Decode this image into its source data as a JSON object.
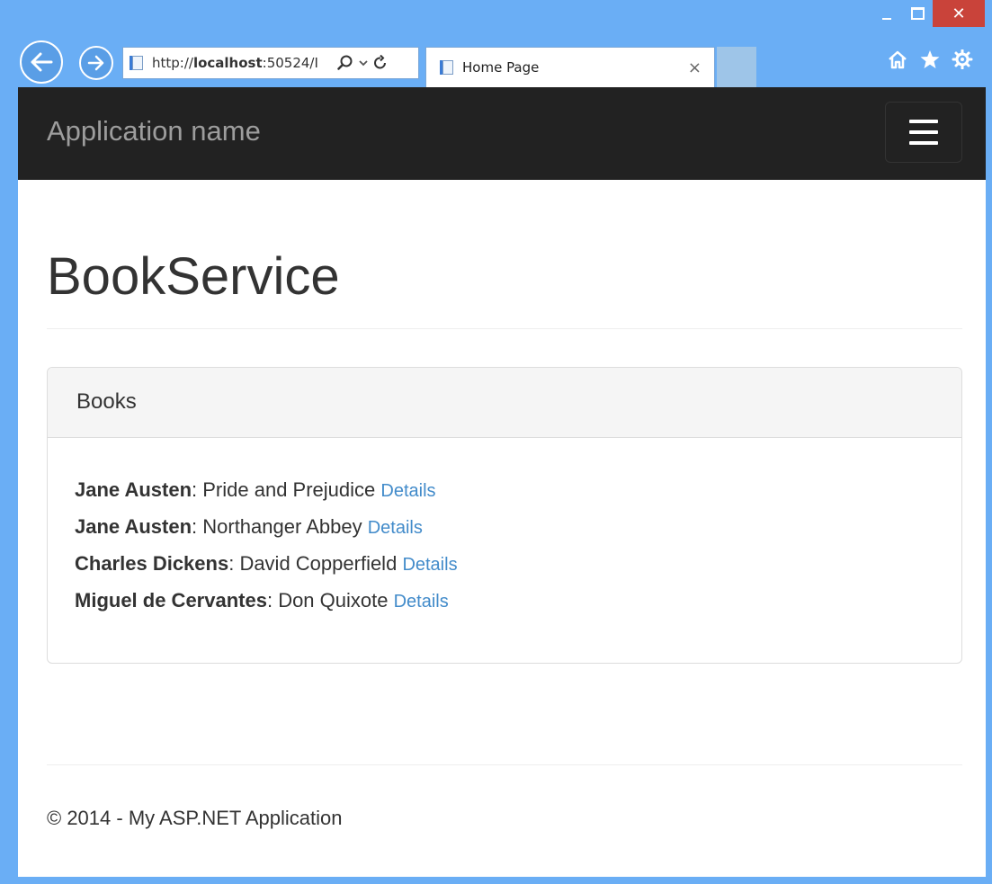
{
  "browser": {
    "url_prefix": "http://",
    "url_host": "localhost",
    "url_rest": ":50524/I",
    "tab_title": "Home Page",
    "tab_close": "×",
    "close_glyph": "✕"
  },
  "navbar": {
    "brand": "Application name"
  },
  "page": {
    "title": "BookService"
  },
  "panel": {
    "title": "Books",
    "books": [
      {
        "author": "Jane Austen",
        "separator": ": ",
        "title": "Pride and Prejudice",
        "link": "Details"
      },
      {
        "author": "Jane Austen",
        "separator": ": ",
        "title": "Northanger Abbey",
        "link": "Details"
      },
      {
        "author": "Charles Dickens",
        "separator": ": ",
        "title": "David Copperfield",
        "link": "Details"
      },
      {
        "author": "Miguel de Cervantes",
        "separator": ": ",
        "title": "Don Quixote",
        "link": "Details"
      }
    ]
  },
  "footer": {
    "text": "© 2014 - My ASP.NET Application"
  },
  "colors": {
    "navbar_bg": "#222222",
    "link": "#428bca",
    "window_frame": "#6aaef5"
  },
  "icons": [
    "back-arrow-icon",
    "forward-arrow-icon",
    "page-icon",
    "search-icon",
    "refresh-icon",
    "home-icon",
    "star-icon",
    "gear-icon",
    "menu-icon"
  ]
}
